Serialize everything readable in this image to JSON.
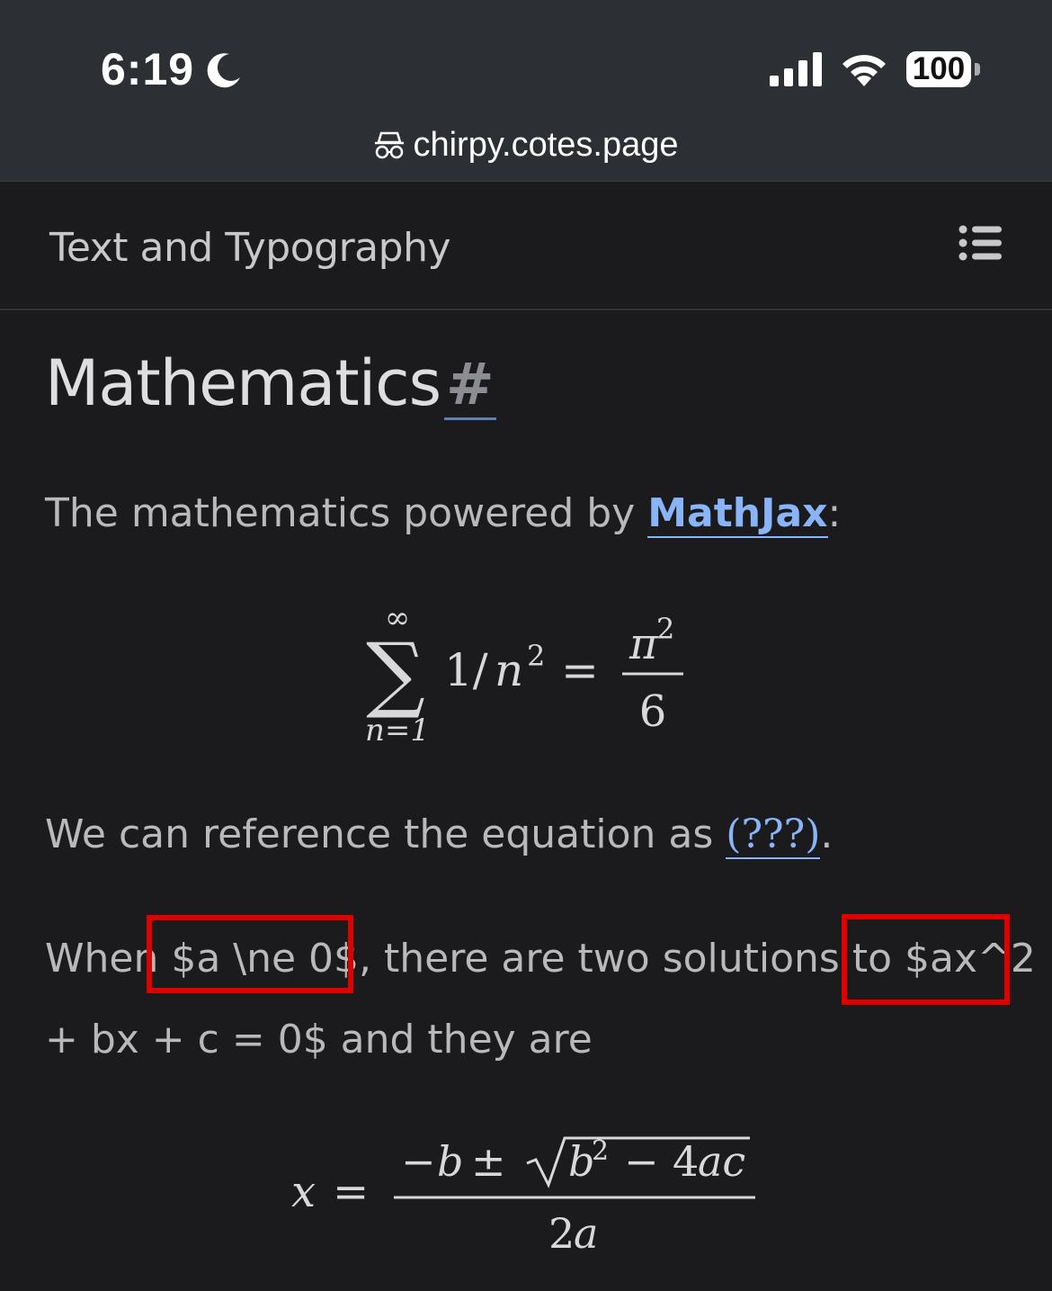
{
  "status_bar": {
    "time": "6:19",
    "battery": "100"
  },
  "browser": {
    "url": "chirpy.cotes.page"
  },
  "site_header": {
    "title": "Text and Typography"
  },
  "content": {
    "heading": "Mathematics",
    "heading_anchor": "#",
    "intro_text": "The mathematics powered by ",
    "intro_link": "MathJax",
    "intro_suffix": ":",
    "equation1": {
      "sum_top": "∞",
      "sum_symbol": "∑",
      "sum_bottom": "n=1",
      "lhs_1": "1/",
      "lhs_n": "n",
      "lhs_exp": "2",
      "equals": "=",
      "num_pi": "π",
      "num_exp": "2",
      "den": "6"
    },
    "reference_text": "We can reference the equation as ",
    "reference_link": "(???)",
    "reference_suffix": ".",
    "when_prefix": "When ",
    "when_math1": "$a \\ne 0$,",
    "when_middle": " there are two solutions to ",
    "when_math2": "$ax^2",
    "when_line2": "+ bx + c = 0$ and they are",
    "equation2": {
      "lhs": "x",
      "equals": "=",
      "num_minus": "−",
      "num_b": "b",
      "num_pm": "±",
      "sqrt_b": "b",
      "sqrt_exp": "2",
      "sqrt_minus": "−",
      "sqrt_4": "4",
      "sqrt_ac": "ac",
      "den_2": "2",
      "den_a": "a"
    }
  },
  "colors": {
    "background": "#1b1b1e",
    "topbar": "#2c2f33",
    "link": "#8ab4f8",
    "highlight_box": "#e00000"
  }
}
